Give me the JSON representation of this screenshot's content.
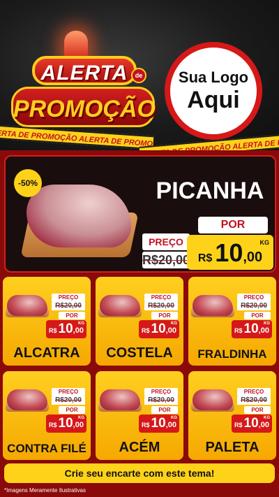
{
  "header": {
    "alerta": "ALERTA",
    "de": "de",
    "promocao": "PROMOÇÃO",
    "logo_line1": "Sua Logo",
    "logo_line2": "Aqui",
    "tape_text": "ALERTA DE PROMOÇÃO   ALERTA DE PROMOÇÃO   ALERTA DE PROMOÇÃO",
    "tape_text2": "ALERTA DE PROMOÇÃO   ALERTA DE PROMOÇÃO"
  },
  "hero": {
    "discount": "-50%",
    "title": "PICANHA",
    "preco_label": "PREÇO",
    "old_price": "R$20,00",
    "por_label": "POR",
    "currency": "R$",
    "price_int": "10",
    "price_dec": ",00",
    "unit": "KG"
  },
  "products": [
    {
      "name": "ALCATRA",
      "preco_label": "PREÇO",
      "old_price": "R$20,00",
      "por_label": "POR",
      "currency": "R$",
      "price_int": "10",
      "price_dec": ",00",
      "unit": "KG"
    },
    {
      "name": "COSTELA",
      "preco_label": "PREÇO",
      "old_price": "R$20,00",
      "por_label": "POR",
      "currency": "R$",
      "price_int": "10",
      "price_dec": ",00",
      "unit": "KG"
    },
    {
      "name": "FRALDINHA",
      "preco_label": "PREÇO",
      "old_price": "R$20,00",
      "por_label": "POR",
      "currency": "R$",
      "price_int": "10",
      "price_dec": ",00",
      "unit": "KG"
    },
    {
      "name": "CONTRA FILÉ",
      "preco_label": "PREÇO",
      "old_price": "R$20,00",
      "por_label": "POR",
      "currency": "R$",
      "price_int": "10",
      "price_dec": ",00",
      "unit": "KG"
    },
    {
      "name": "ACÉM",
      "preco_label": "PREÇO",
      "old_price": "R$20,00",
      "por_label": "POR",
      "currency": "R$",
      "price_int": "10",
      "price_dec": ",00",
      "unit": "KG"
    },
    {
      "name": "PALETA",
      "preco_label": "PREÇO",
      "old_price": "R$20,00",
      "por_label": "POR",
      "currency": "R$",
      "price_int": "10",
      "price_dec": ",00",
      "unit": "KG"
    }
  ],
  "cta": "Crie seu encarte com este tema!",
  "footnote": "*Imagens Meramente Ilustrativas",
  "colors": {
    "red": "#d61818",
    "yellow": "#ffd21a",
    "dark": "#1b1b1b"
  }
}
